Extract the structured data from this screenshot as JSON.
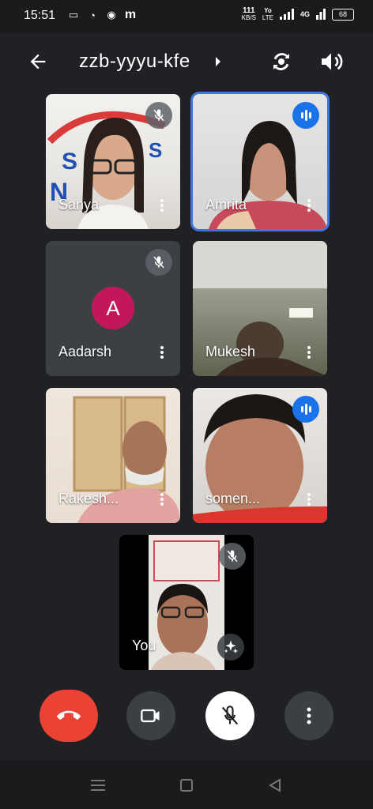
{
  "status_bar": {
    "time": "15:51",
    "app_icons": [
      "video-icon",
      "whatsapp-icon",
      "signal-app-icon",
      "m-app-icon"
    ],
    "app_glyphs": [
      "▭",
      "◔",
      "◉",
      "m"
    ],
    "net_speed_value": "111",
    "net_speed_unit": "KB/S",
    "volte_top": "Yo",
    "volte_bottom": "LTE",
    "network": "4G",
    "battery": "68"
  },
  "header": {
    "meeting_code": "zzb-yyyu-kfe"
  },
  "participants": [
    {
      "name": "Sanya",
      "state": "muted"
    },
    {
      "name": "Amrita",
      "state": "speaking"
    },
    {
      "name": "Aadarsh",
      "state": "muted",
      "avatar_letter": "A"
    },
    {
      "name": "Mukesh",
      "state": "none"
    },
    {
      "name": "Rakesh...",
      "state": "none"
    },
    {
      "name": "somen...",
      "state": "speaking"
    },
    {
      "name": "You",
      "state": "muted"
    }
  ],
  "colors": {
    "background": "#202124",
    "end_call": "#ea4335",
    "speaking_badge": "#1a73e8",
    "active_border": "#3f74d8",
    "avatar": "#c2185b"
  }
}
